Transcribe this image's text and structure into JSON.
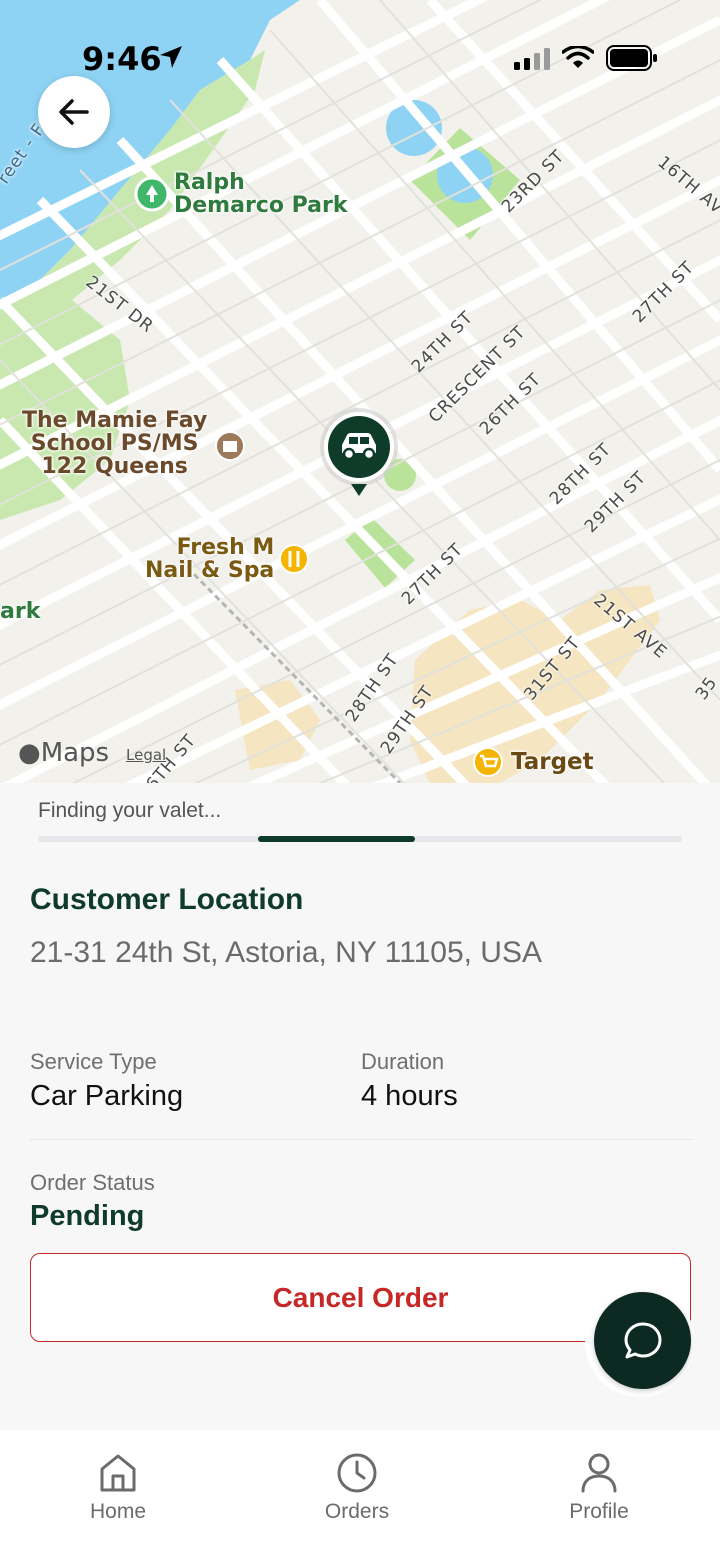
{
  "status_bar": {
    "time": "9:46"
  },
  "map": {
    "pois": {
      "park1": "Ralph\nDemarco Park",
      "school": "The Mamie Fay\nSchool PS/MS\n122 Queens",
      "nail": "Fresh M\nNail & Spa",
      "target": "Target",
      "park_edge": "ark"
    },
    "streets": {
      "s21dr": "21ST DR",
      "s23rd": "23RD ST",
      "s16th": "16TH AV",
      "s27th_a": "27TH ST",
      "s24th": "24TH ST",
      "crescent": "CRESCENT ST",
      "s26th": "26TH ST",
      "s28th_a": "28TH ST",
      "s29th_a": "29TH ST",
      "s27th_b": "27TH ST",
      "s21ave": "21ST AVE",
      "s28th_b": "28TH ST",
      "s29th_b": "29TH ST",
      "s31st": "31ST ST",
      "s6th": "6TH ST",
      "ferry": "reet - Ferry",
      "s35": "35"
    },
    "branding": {
      "maps": "Maps",
      "legal": "Legal"
    }
  },
  "sheet": {
    "finding_text": "Finding your valet...",
    "progress": {
      "indeterminate": true
    },
    "location_title": "Customer Location",
    "address": "21-31 24th St, Astoria, NY 11105, USA",
    "service_type_label": "Service Type",
    "service_type_value": "Car Parking",
    "duration_label": "Duration",
    "duration_value": "4 hours",
    "order_status_label": "Order Status",
    "order_status_value": "Pending",
    "cancel_label": "Cancel Order"
  },
  "tabbar": {
    "tabs": [
      {
        "label": "Home",
        "icon": "home-icon"
      },
      {
        "label": "Orders",
        "icon": "clock-icon"
      },
      {
        "label": "Profile",
        "icon": "person-icon"
      }
    ]
  },
  "colors": {
    "brand_dark_green": "#0f3b2a",
    "cancel_red": "#c62828",
    "water": "#8fd3f4",
    "park": "#bfe3a5"
  }
}
